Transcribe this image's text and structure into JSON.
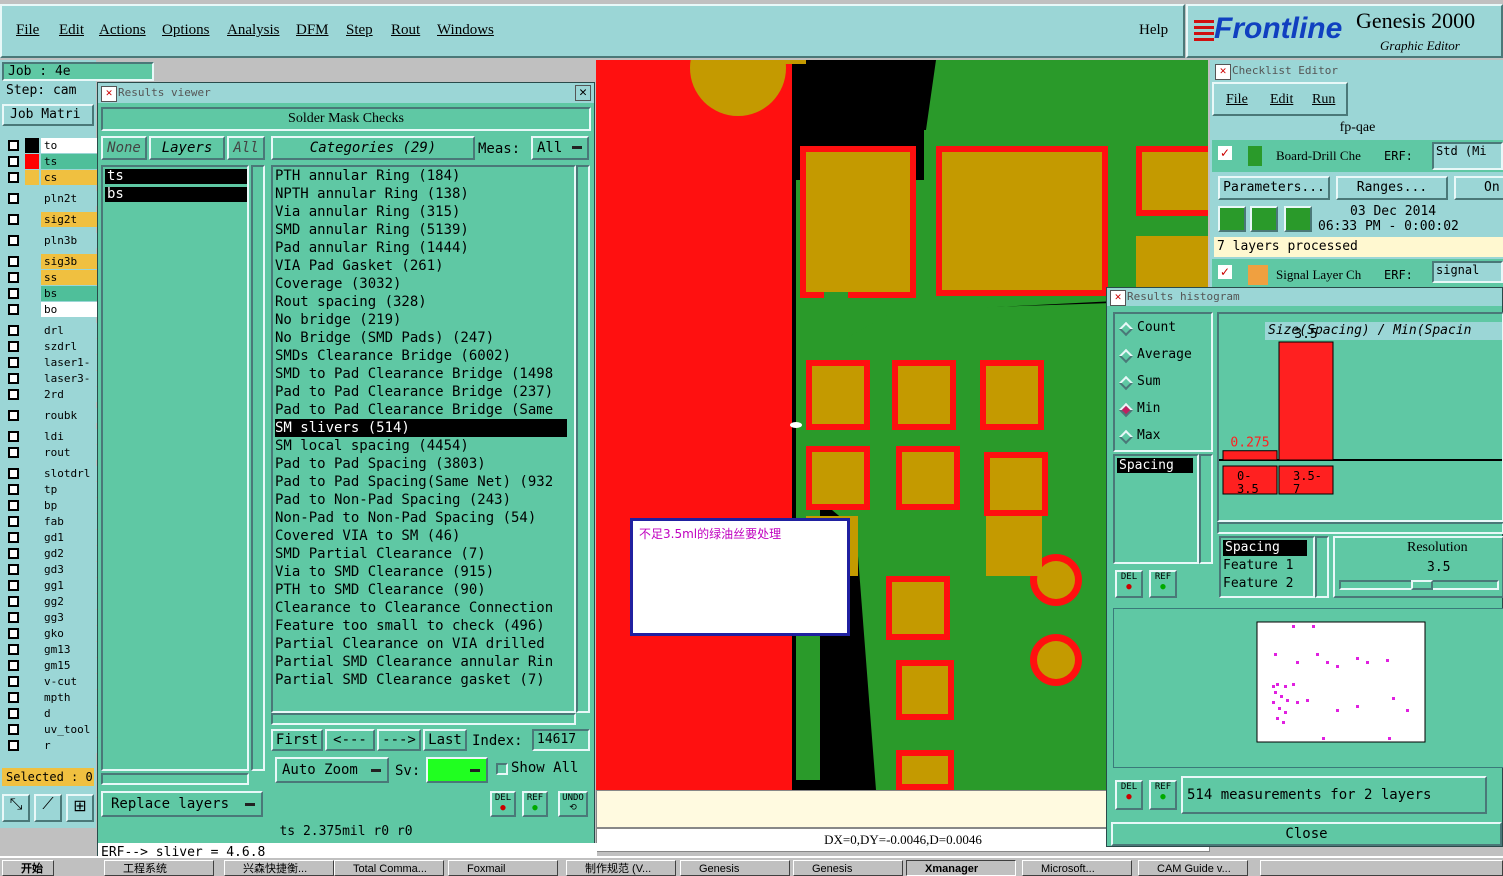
{
  "menubar": {
    "items": [
      "File",
      "Edit",
      "Actions",
      "Options",
      "Analysis",
      "DFM",
      "Step",
      "Rout",
      "Windows"
    ],
    "help": "Help"
  },
  "brand": {
    "name": "Frontline",
    "product": "Genesis 2000",
    "subtitle": "Graphic Editor"
  },
  "job_panel": {
    "job": "Job : 4e",
    "step": "Step: cam",
    "matrix_label": "Job Matri",
    "layers": [
      {
        "name": "to",
        "color": "#ffffff",
        "mark": "#000000"
      },
      {
        "name": "ts",
        "color": "#4fbf9a",
        "mark": "#ff0000"
      },
      {
        "name": "cs",
        "color": "#f0c040",
        "mark": "#f0c040"
      },
      {
        "name": "pln2t",
        "color": "#9bd6d6",
        "mark": ""
      },
      {
        "name": "sig2t",
        "color": "#f0c040",
        "mark": ""
      },
      {
        "name": "pln3b",
        "color": "#9bd6d6",
        "mark": ""
      },
      {
        "name": "sig3b",
        "color": "#f0c040",
        "mark": ""
      },
      {
        "name": "ss",
        "color": "#f0c040",
        "mark": ""
      },
      {
        "name": "bs",
        "color": "#4fbf9a",
        "mark": ""
      },
      {
        "name": "bo",
        "color": "#ffffff",
        "mark": ""
      },
      {
        "name": "drl",
        "color": "#9bd6d6",
        "mark": ""
      },
      {
        "name": "szdrl",
        "color": "#9bd6d6",
        "mark": ""
      },
      {
        "name": "laser1-",
        "color": "#9bd6d6",
        "mark": ""
      },
      {
        "name": "laser3-",
        "color": "#9bd6d6",
        "mark": ""
      },
      {
        "name": "2rd",
        "color": "#9bd6d6",
        "mark": ""
      },
      {
        "name": "roubk",
        "color": "#9bd6d6",
        "mark": ""
      },
      {
        "name": "ldi",
        "color": "#9bd6d6",
        "mark": ""
      },
      {
        "name": "rout",
        "color": "#9bd6d6",
        "mark": ""
      },
      {
        "name": "slotdrl",
        "color": "#9bd6d6",
        "mark": ""
      },
      {
        "name": "tp",
        "color": "#9bd6d6",
        "mark": ""
      },
      {
        "name": "bp",
        "color": "#9bd6d6",
        "mark": ""
      },
      {
        "name": "fab",
        "color": "#9bd6d6",
        "mark": ""
      },
      {
        "name": "gd1",
        "color": "#9bd6d6",
        "mark": ""
      },
      {
        "name": "gd2",
        "color": "#9bd6d6",
        "mark": ""
      },
      {
        "name": "gd3",
        "color": "#9bd6d6",
        "mark": ""
      },
      {
        "name": "gg1",
        "color": "#9bd6d6",
        "mark": ""
      },
      {
        "name": "gg2",
        "color": "#9bd6d6",
        "mark": ""
      },
      {
        "name": "gg3",
        "color": "#9bd6d6",
        "mark": ""
      },
      {
        "name": "gko",
        "color": "#9bd6d6",
        "mark": ""
      },
      {
        "name": "gm13",
        "color": "#9bd6d6",
        "mark": ""
      },
      {
        "name": "gm15",
        "color": "#9bd6d6",
        "mark": ""
      },
      {
        "name": "v-cut",
        "color": "#9bd6d6",
        "mark": ""
      },
      {
        "name": "mpth",
        "color": "#9bd6d6",
        "mark": ""
      },
      {
        "name": "d",
        "color": "#9bd6d6",
        "mark": ""
      },
      {
        "name": "uv_tool",
        "color": "#9bd6d6",
        "mark": ""
      },
      {
        "name": "r",
        "color": "#9bd6d6",
        "mark": ""
      }
    ],
    "selected": "Selected : 0"
  },
  "results_viewer": {
    "title": "Results viewer",
    "header": "Solder Mask Checks",
    "none_btn": "None",
    "layers_btn": "Layers",
    "all_btn": "All",
    "categories_btn": "Categories (29)",
    "meas_label": "Meas:",
    "meas_value": "All",
    "layer_list": [
      "ts",
      "bs"
    ],
    "categories": [
      "PTH annular Ring (184)",
      "NPTH annular Ring (138)",
      "Via annular Ring (315)",
      "SMD annular Ring (5139)",
      "Pad annular Ring (1444)",
      "VIA Pad Gasket (261)",
      "Coverage (3032)",
      "Rout spacing (328)",
      "No bridge (219)",
      "No Bridge (SMD Pads) (247)",
      "SMDs Clearance Bridge (6002)",
      "SMD to Pad Clearance Bridge (1498",
      "Pad to Pad Clearance Bridge (237)",
      "Pad to Pad Clearance Bridge (Same",
      "SM slivers (514)",
      "SM local spacing (4454)",
      "Pad to Pad Spacing (3803)",
      "Pad to Pad Spacing(Same Net) (932",
      "Pad to Non-Pad Spacing (243)",
      "Non-Pad to Non-Pad Spacing (54)",
      "Covered VIA to SM (46)",
      "SMD Partial Clearance (7)",
      "Via to SMD Clearance (915)",
      "PTH to SMD Clearance (90)",
      "Clearance to Clearance Connection",
      "Feature too small to check (496)",
      "Partial Clearance on VIA drilled",
      "Partial SMD Clearance annular Rin",
      "Partial SMD Clearance gasket (7)"
    ],
    "selected_index": 14,
    "nav": {
      "first": "First",
      "prev": "<---",
      "next": "--->",
      "last": "Last",
      "index_label": "Index:",
      "index_value": "14617"
    },
    "zoom": "Auto Zoom",
    "sv_label": "Sv:",
    "show_all": "Show All",
    "replace_layers": "Replace layers",
    "del": "DEL",
    "ref": "REF",
    "undo": "UNDO",
    "status": "ts 2.375mil  r0  r0",
    "err": "ERF--> sliver = 4.6.8"
  },
  "canvas": {
    "note": "不足3.5ml的绿油丝要处理",
    "coords": "DX=0,DY=-0.0046,D=0.0046"
  },
  "checklist": {
    "title": "Checklist Editor",
    "menu": [
      "File",
      "Edit",
      "Run"
    ],
    "name": "fp-qae",
    "row1_label": "Board-Drill Che",
    "erf_label": "ERF:",
    "row1_erf": "Std (Mi",
    "parameters": "Parameters...",
    "ranges": "Ranges...",
    "on": "On",
    "date": "03 Dec 2014",
    "time": "06:33 PM - 0:00:02",
    "processed": "7 layers processed",
    "row2_label": "Signal Layer Ch",
    "row2_erf": "signal"
  },
  "histogram": {
    "title": "Results histogram",
    "modes": [
      "Count",
      "Average",
      "Sum",
      "Min",
      "Max"
    ],
    "selected_mode": "Min",
    "chart_title": "Size(Spacing) / Min(Spacin",
    "list_item": "Spacing",
    "del": "DEL",
    "ref": "REF",
    "chart_data": {
      "type": "bar",
      "categories": [
        "0-3.5",
        "3.5-7"
      ],
      "values": [
        0.275,
        3.5
      ],
      "bin_labels_top": [
        "0-",
        "3.5-"
      ],
      "bin_labels_bottom": [
        "3.5",
        "7"
      ],
      "colors": [
        "#ff2020",
        "#ff2020"
      ]
    },
    "features": [
      "Spacing",
      "Feature 1",
      "Feature 2"
    ],
    "resolution_label": "Resolution",
    "resolution_value": "3.5",
    "summary": "514 measurements for 2 layers",
    "close": "Close"
  },
  "taskbar": {
    "start": "开始",
    "tasks": [
      "工程系统",
      "兴森快捷衡...",
      "Total Comma...",
      "Foxmail",
      "制作规范 (V...",
      "Genesis",
      "Genesis",
      "Xmanager",
      "Microsoft...",
      "CAM Guide v..."
    ]
  }
}
